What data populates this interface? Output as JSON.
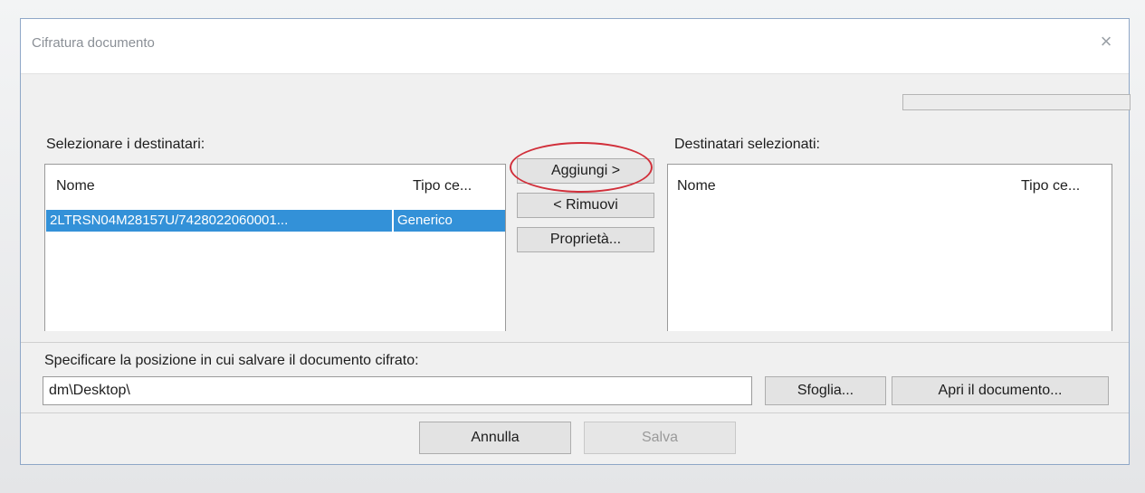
{
  "window": {
    "title": "Cifratura documento",
    "close_symbol": "×"
  },
  "left_panel": {
    "label": "Selezionare i destinatari:",
    "columns": [
      "Nome",
      "Tipo ce..."
    ],
    "rows": [
      {
        "name": "2LTRSN04M28157U/7428022060001...",
        "type": "Generico",
        "selected": true
      }
    ]
  },
  "actions": {
    "add": "Aggiungi >",
    "remove": "< Rimuovi",
    "properties": "Proprietà..."
  },
  "right_panel": {
    "label": "Destinatari selezionati:",
    "columns": [
      "Nome",
      "Tipo ce..."
    ],
    "rows": []
  },
  "save_location": {
    "label": "Specificare la posizione in cui salvare il documento cifrato:",
    "path_value": "dm\\Desktop\\",
    "browse": "Sfoglia...",
    "open_document": "Apri il documento..."
  },
  "footer": {
    "cancel": "Annulla",
    "save": "Salva"
  },
  "progress": 0,
  "colors": {
    "selection": "#3391d8",
    "annotation": "#d12f3a",
    "dialog_border": "#8fa7c7"
  },
  "icons": [
    "close-icon"
  ]
}
